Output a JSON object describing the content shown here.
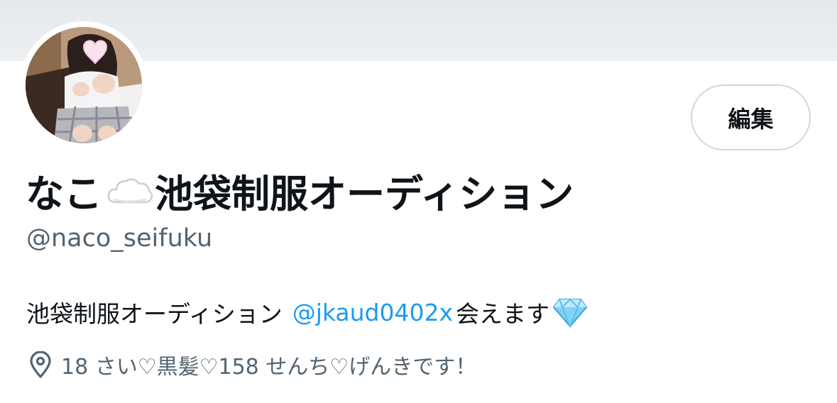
{
  "header": {
    "banner_color": "#e8ebee"
  },
  "profile": {
    "avatar_icon": "profile-photo",
    "edit_label": "編集",
    "name_part1": "なこ",
    "name_emoji": "cloud-emoji",
    "name_part2": "池袋制服オーディション",
    "handle": "@naco_seifuku",
    "bio_text": "池袋制服オーディション",
    "bio_link": "@jkaud0402x",
    "bio_after": "会えます",
    "bio_emoji": "gem-emoji",
    "location": "18 さい♡黒髪♡158 せんち♡げんきです！",
    "location_icon": "map-pin-icon"
  },
  "colors": {
    "text_primary": "#0f1419",
    "text_secondary": "#536471",
    "link": "#1d9bf0",
    "button_border": "#cfd9de"
  }
}
